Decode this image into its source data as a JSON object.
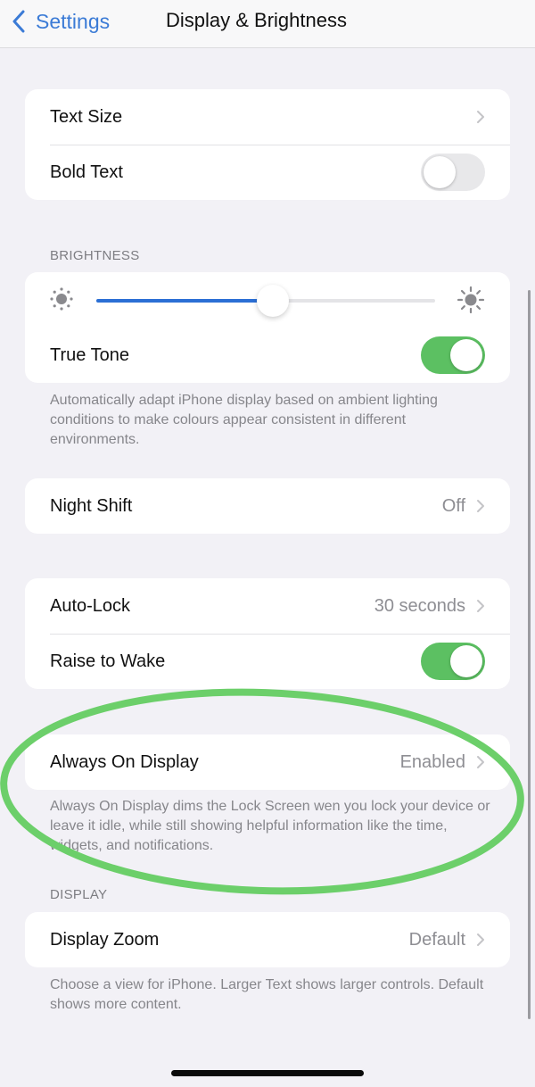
{
  "nav": {
    "back_label": "Settings",
    "title": "Display & Brightness"
  },
  "group_text": {
    "rows": [
      {
        "label": "Text Size",
        "accessory": "chevron"
      },
      {
        "label": "Bold Text",
        "accessory": "toggle",
        "on": false
      }
    ]
  },
  "brightness": {
    "header": "BRIGHTNESS",
    "level_percent": 52,
    "true_tone_label": "True Tone",
    "true_tone_on": true,
    "footer": "Automatically adapt iPhone display based on ambient lighting conditions to make colours appear consistent in different environments."
  },
  "night_shift": {
    "label": "Night Shift",
    "value": "Off"
  },
  "lock_group": {
    "auto_lock_label": "Auto-Lock",
    "auto_lock_value": "30 seconds",
    "raise_to_wake_label": "Raise to Wake",
    "raise_to_wake_on": true
  },
  "always_on": {
    "label": "Always On Display",
    "value": "Enabled",
    "footer": "Always On Display dims the Lock Screen wen you lock your device or leave it idle, while still showing helpful information like the time, widgets, and notifications."
  },
  "display": {
    "header": "DISPLAY",
    "zoom_label": "Display Zoom",
    "zoom_value": "Default",
    "footer": "Choose a view for iPhone. Larger Text shows larger controls. Default shows more content."
  },
  "colors": {
    "accent_blue": "#3b7bd6",
    "slider_blue": "#2b6fd5",
    "toggle_green": "#5cc062",
    "annotation_green": "#6ccf6a"
  }
}
